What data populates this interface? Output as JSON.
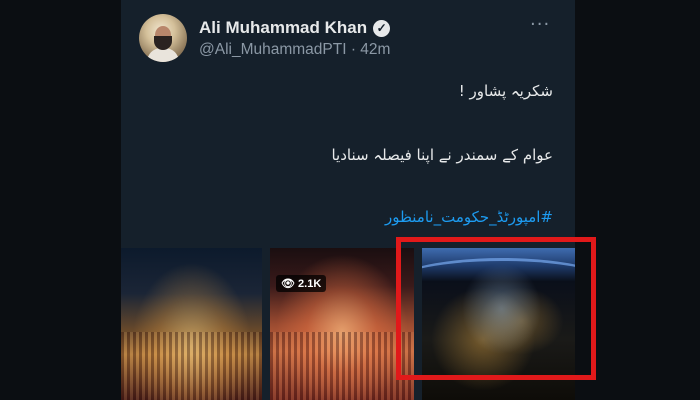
{
  "tweet": {
    "author_name": "Ali Muhammad Khan",
    "handle_time": "@Ali_MuhammadPTI · 42m",
    "more_glyph": "···",
    "verified_glyph": "✓",
    "line1": "شکریہ پشاور !",
    "line2": "عوام کے سمندر نے اپنا فیصلہ سنادیا",
    "hashtag": "#امپورٹڈ_حکومت_نامنظور"
  },
  "media": {
    "video_views": "👁 2.1K"
  },
  "colors": {
    "background": "#15202b",
    "link": "#1d9bf0",
    "highlight_box": "#e1191a"
  }
}
